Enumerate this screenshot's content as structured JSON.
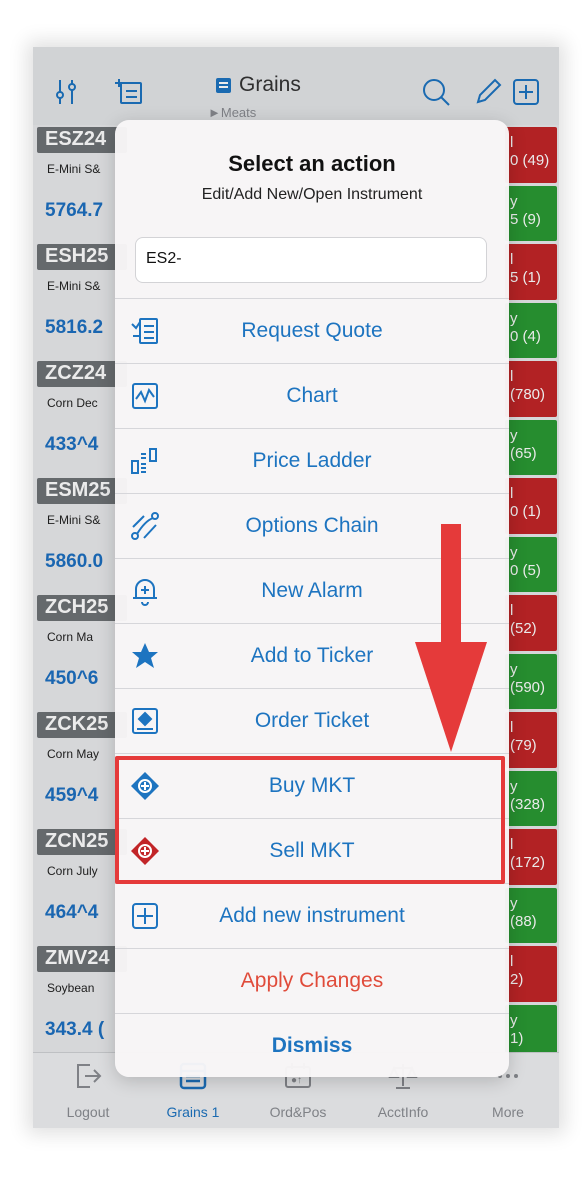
{
  "header": {
    "title": "Grains",
    "subtitle": "►Meats"
  },
  "list": [
    {
      "symbol": "ESZ24",
      "desc": "E-Mini S&",
      "price": "5764.7",
      "sell": "l\n0 (49)",
      "buy": "y\n5 (9)"
    },
    {
      "symbol": "ESH25",
      "desc": "E-Mini S&",
      "price": "5816.2",
      "sell": "l\n5 (1)",
      "buy": "y\n0 (4)"
    },
    {
      "symbol": "ZCZ24",
      "desc": "Corn Dec",
      "price": "433^4",
      "sell": "l\n(780)",
      "buy": "y\n(65)"
    },
    {
      "symbol": "ESM25",
      "desc": "E-Mini S&",
      "price": "5860.0",
      "sell": "l\n0 (1)",
      "buy": "y\n0 (5)"
    },
    {
      "symbol": "ZCH25",
      "desc": "Corn Ma",
      "price": "450^6",
      "sell": "l\n(52)",
      "buy": "y\n(590)"
    },
    {
      "symbol": "ZCK25",
      "desc": "Corn May",
      "price": "459^4",
      "sell": "l\n(79)",
      "buy": "y\n(328)"
    },
    {
      "symbol": "ZCN25",
      "desc": "Corn July",
      "price": "464^4",
      "sell": "l\n(172)",
      "buy": "y\n(88)"
    },
    {
      "symbol": "ZMV24",
      "desc": "Soybean",
      "price": "343.4 (",
      "sell": "l\n2)",
      "buy": "y\n1)"
    }
  ],
  "sheet": {
    "title": "Select an action",
    "subtitle": "Edit/Add New/Open Instrument",
    "input_value": "ES2-",
    "actions": [
      {
        "label": "Request Quote",
        "icon": "request-quote-icon"
      },
      {
        "label": "Chart",
        "icon": "chart-icon"
      },
      {
        "label": "Price Ladder",
        "icon": "price-ladder-icon"
      },
      {
        "label": "Options Chain",
        "icon": "options-chain-icon"
      },
      {
        "label": "New Alarm",
        "icon": "alarm-icon"
      },
      {
        "label": "Add to Ticker",
        "icon": "star-icon"
      },
      {
        "label": "Order Ticket",
        "icon": "order-ticket-icon"
      },
      {
        "label": "Buy MKT",
        "icon": "buy-diamond-icon"
      },
      {
        "label": "Sell MKT",
        "icon": "sell-diamond-icon"
      },
      {
        "label": "Add new instrument",
        "icon": "plus-square-icon"
      },
      {
        "label": "Apply Changes",
        "icon": ""
      },
      {
        "label": "Dismiss",
        "icon": ""
      }
    ]
  },
  "tabs": [
    {
      "label": "Logout",
      "icon": "logout-icon"
    },
    {
      "label": "Grains 1",
      "icon": "grid-icon"
    },
    {
      "label": "Ord&Pos",
      "icon": "ordpos-icon"
    },
    {
      "label": "AcctInfo",
      "icon": "scales-icon"
    },
    {
      "label": "More",
      "icon": "more-icon"
    }
  ],
  "colors": {
    "accent": "#1d74c0",
    "sell": "#c22528",
    "buy": "#2a9a34",
    "danger": "#e04b3a",
    "highlight": "#e53a3a"
  }
}
